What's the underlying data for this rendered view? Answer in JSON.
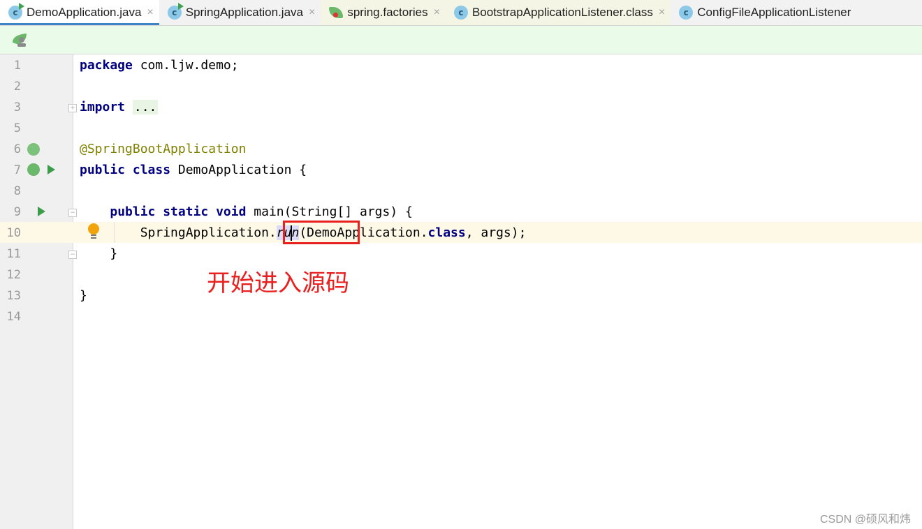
{
  "tabs": [
    {
      "label": "DemoApplication.java",
      "icon": "java-class-run-icon",
      "active": true
    },
    {
      "label": "SpringApplication.java",
      "icon": "java-class-icon",
      "active": false
    },
    {
      "label": "spring.factories",
      "icon": "spring-factories-icon",
      "active": false
    },
    {
      "label": "BootstrapApplicationListener.class",
      "icon": "class-locked-icon",
      "active": false
    },
    {
      "label": "ConfigFileApplicationListener",
      "icon": "class-icon",
      "active": false
    }
  ],
  "close_glyph": "×",
  "editor": {
    "lines": [
      {
        "num": "1"
      },
      {
        "num": "2"
      },
      {
        "num": "3"
      },
      {
        "num": "5"
      },
      {
        "num": "6"
      },
      {
        "num": "7"
      },
      {
        "num": "8"
      },
      {
        "num": "9"
      },
      {
        "num": "10"
      },
      {
        "num": "11"
      },
      {
        "num": "12"
      },
      {
        "num": "13"
      },
      {
        "num": "14"
      }
    ],
    "code": {
      "l1_kw": "package",
      "l1_rest": " com.ljw.demo;",
      "l3_kw": "import",
      "l3_dots": "...",
      "l6_ann": "@SpringBootApplication",
      "l7_kw": "public class",
      "l7_rest": " DemoApplication {",
      "l9_indent": "    ",
      "l9_kw": "public static void",
      "l9_rest": " main(String[] args) {",
      "l10_indent": "        ",
      "l10_a": "SpringApplication.",
      "l10_run1": "ru",
      "l10_run2": "n",
      "l10_b": "(DemoApplication.",
      "l10_kw": "class",
      "l10_c": ", args);",
      "l11": "    }",
      "l13": "}"
    }
  },
  "annotation_text": "开始进入源码",
  "watermark": "CSDN @硕风和炜"
}
